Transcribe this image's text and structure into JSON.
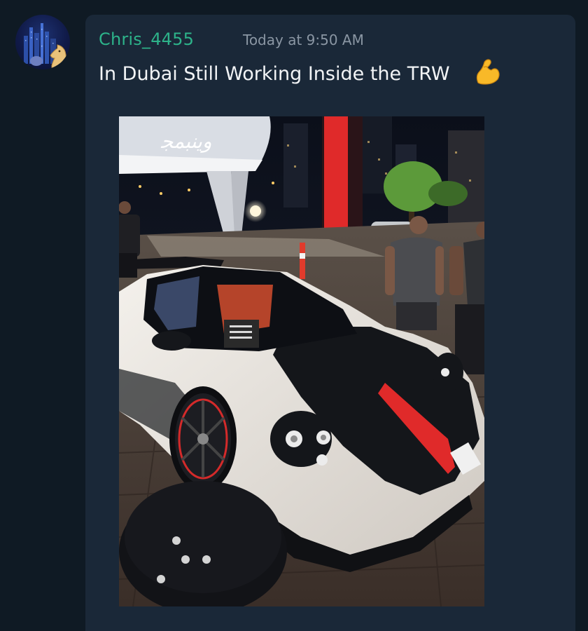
{
  "message": {
    "author": "Chris_4455",
    "timestamp": "Today at 9:50 AM",
    "text": "In Dubai Still Working Inside the TRW",
    "emoji": "flexed-biceps-emoji"
  },
  "avatar": {
    "icon": "chess-knight-icon"
  },
  "attachment": {
    "type": "image",
    "sign_text": "Dubai Mall Arabic signage"
  },
  "colors": {
    "background": "#0f1a24",
    "card": "#1a2838",
    "username": "#2db38a",
    "timestamp": "#8a96a3",
    "text": "#f2f4f6"
  }
}
